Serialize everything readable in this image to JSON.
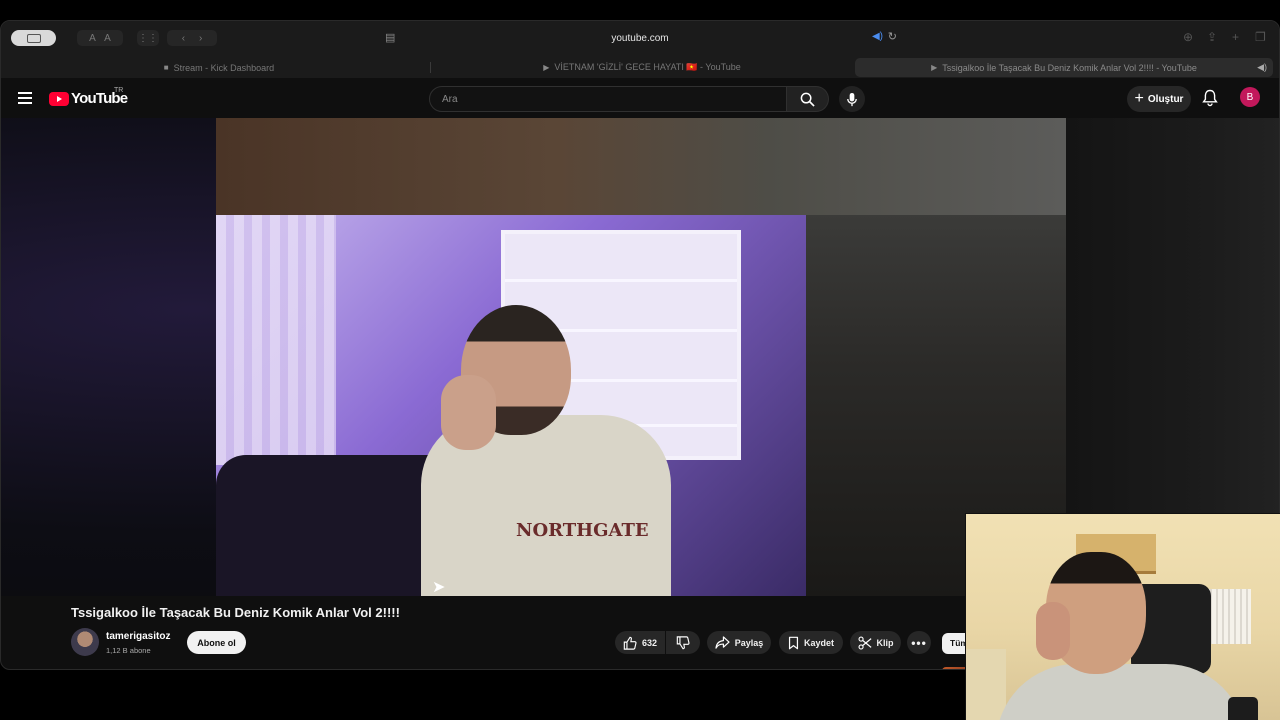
{
  "browser": {
    "url": "youtube.com",
    "tabs": [
      {
        "label": "Stream - Kick Dashboard",
        "active": false
      },
      {
        "label": "VİETNAM 'GİZLİ' GECE HAYATI 🇻🇳 - YouTube",
        "active": false
      },
      {
        "label": "Tssigalkoo İle Taşacak Bu Deniz Komik Anlar Vol 2!!!! - YouTube",
        "active": true
      }
    ]
  },
  "header": {
    "logo_text": "YouTube",
    "country_code": "TR",
    "search_placeholder": "Ara",
    "create_label": "Oluştur",
    "avatar_letter": "B"
  },
  "video": {
    "watermark": "tamerigasitoz",
    "title": "Tssigalkoo İle Taşacak Bu Deniz Komik Anlar Vol 2!!!!",
    "shirt_print": "NORTHGATE"
  },
  "channel": {
    "name": "tamerigasitoz",
    "subscribers": "1,12 B abone",
    "subscribe_label": "Abone ol"
  },
  "actions": {
    "like_count": "632",
    "share_label": "Paylaş",
    "save_label": "Kaydet",
    "clip_label": "Klip"
  },
  "recommendations": {
    "chip_label": "Tüm"
  },
  "colors": {
    "brand_red": "#ff0033",
    "page_bg": "#0f0f0f",
    "avatar_bg": "#c2185b",
    "audio_blue": "#4a8df0"
  }
}
